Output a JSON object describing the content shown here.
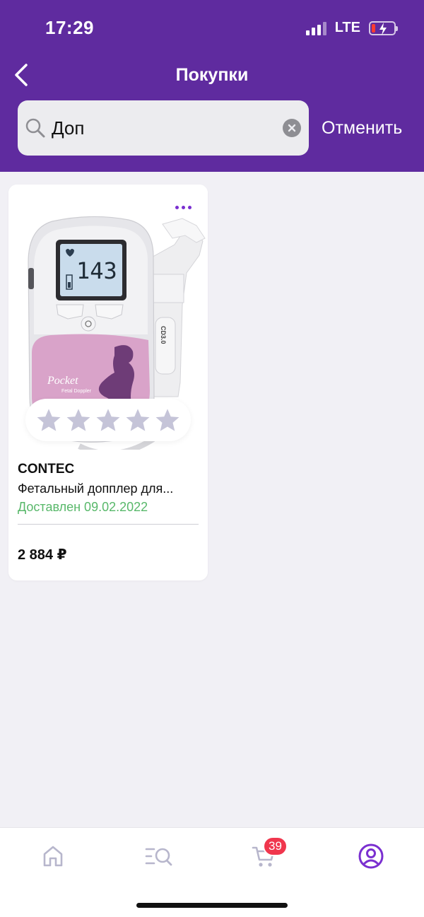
{
  "status_bar": {
    "time": "17:29",
    "network": "LTE"
  },
  "header": {
    "title": "Покупки",
    "cancel_label": "Отменить"
  },
  "search": {
    "value": "Доп"
  },
  "product": {
    "brand": "CONTEC",
    "name": "Фетальный допплер для...",
    "delivery_status": "Доставлен 09.02.2022",
    "price": "2 884 ₽",
    "rating_stars": 0,
    "rating_max": 5,
    "image_texts": {
      "display_value": "143",
      "brand_text": "Pocket",
      "subtitle": "Fetal Doppler",
      "probe_label": "CD3.0"
    }
  },
  "tabbar": {
    "items": [
      "home-icon",
      "catalog-search-icon",
      "cart-icon",
      "profile-icon"
    ],
    "cart_badge": "39"
  },
  "colors": {
    "header": "#5f2b9f",
    "accent": "#7a2fd0",
    "delivered": "#58b86a",
    "badge": "#f0364d",
    "inactive_icon": "#b7b6cc"
  }
}
